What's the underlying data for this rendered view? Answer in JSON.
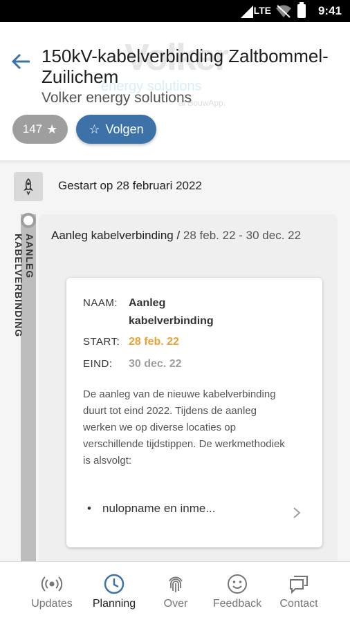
{
  "status_bar": {
    "network": "LTE",
    "time": "9:41"
  },
  "header": {
    "back_icon": "arrow-left-icon",
    "title": "150kV-kabelverbinding Zaltbommel-Zuilichem",
    "subtitle": "Volker energy solutions",
    "watermark": {
      "brand": "Volker",
      "tagline": "energy solutions",
      "note": "at BouwApp."
    },
    "follower_count": "147",
    "follow_label": "Volgen"
  },
  "content": {
    "started_text": "Gestart op 28 februari 2022",
    "rail_label": "AANLEG KABELVERBINDING",
    "phase": {
      "title": "Aanleg kabelverbinding /",
      "dates": "28 feb. 22 - 30 dec. 22",
      "details": {
        "name_label": "NAAM:",
        "name_value": "Aanleg kabelverbinding",
        "start_label": "START:",
        "start_value": "28 feb. 22",
        "end_label": "EIND:",
        "end_value": "30 dec. 22",
        "description": "De aanleg van de nieuwe kabelverbinding duurt tot eind 2022. Tijdens de aanleg werken we op diverse locaties op verschillende tijdstippen. De werkmethodiek is alsvolgt:",
        "bullet": "nulopname en inme..."
      }
    }
  },
  "bottom_nav": {
    "items": [
      {
        "label": "Updates",
        "icon": "broadcast-icon",
        "active": false
      },
      {
        "label": "Planning",
        "icon": "clock-icon",
        "active": true
      },
      {
        "label": "Over",
        "icon": "fingerprint-icon",
        "active": false
      },
      {
        "label": "Feedback",
        "icon": "smiley-icon",
        "active": false
      },
      {
        "label": "Contact",
        "icon": "chat-icon",
        "active": false
      }
    ]
  },
  "colors": {
    "accent": "#3d72a9",
    "start": "#f0a030",
    "end": "#9e9e9e"
  }
}
